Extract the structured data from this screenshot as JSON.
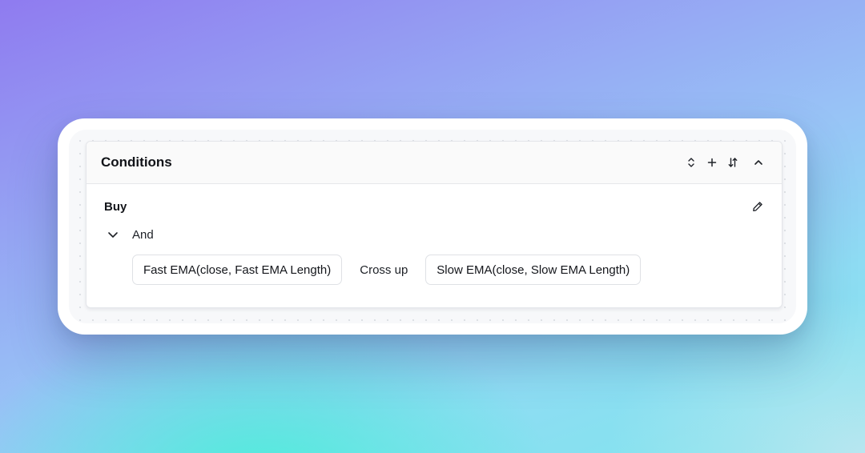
{
  "panel": {
    "title": "Conditions",
    "actions": [
      {
        "icon": "chevron-up-down-icon"
      },
      {
        "icon": "plus-icon"
      },
      {
        "icon": "sort-arrows-icon"
      },
      {
        "icon": "chevron-up-icon"
      }
    ]
  },
  "group": {
    "name": "Buy",
    "logic": "And",
    "condition": {
      "left_operand": "Fast EMA(close, Fast EMA Length)",
      "operator": "Cross up",
      "right_operand": "Slow EMA(close, Slow EMA Length)"
    }
  },
  "colors": {
    "title_text": "#111318",
    "panel_border": "#e4e6ea",
    "header_bg": "#fafafa"
  }
}
